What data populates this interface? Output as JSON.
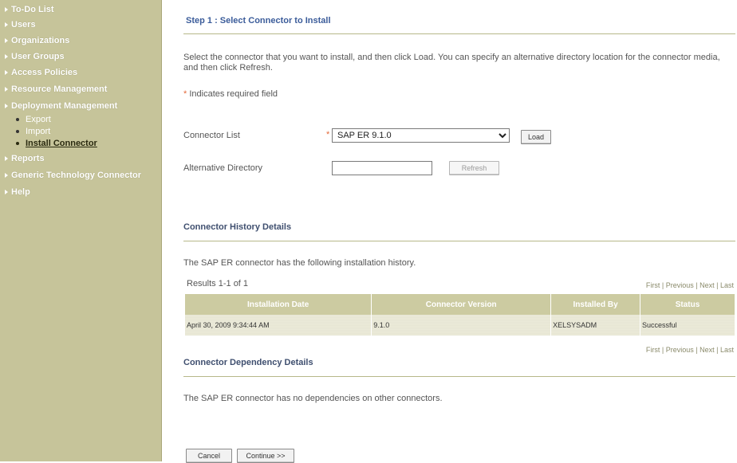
{
  "sidebar": {
    "items": [
      {
        "label": "To-Do List"
      },
      {
        "label": "Users"
      },
      {
        "label": "Organizations"
      },
      {
        "label": "User Groups"
      },
      {
        "label": "Access Policies"
      },
      {
        "label": "Resource Management"
      },
      {
        "label": "Deployment Management"
      },
      {
        "label": "Reports"
      },
      {
        "label": "Generic Technology Connector"
      },
      {
        "label": "Help"
      }
    ],
    "sub_items": [
      {
        "label": "Export"
      },
      {
        "label": "Import"
      },
      {
        "label": "Install Connector",
        "active": true
      }
    ]
  },
  "main": {
    "step_title": "Step 1 : Select Connector to Install",
    "instructions": "Select the connector that you want to install, and then click Load.  You can specify an alternative directory location for the connector media, and then click Refresh.",
    "required_star": "*",
    "required_note": "Indicates required field",
    "connector_list_label": "Connector List",
    "connector_selected": "SAP ER 9.1.0",
    "load_label": "Load",
    "alt_dir_label": "Alternative Directory",
    "alt_dir_value": "",
    "refresh_label": "Refresh",
    "history_title": "Connector History Details",
    "history_text": "The SAP ER connector has the following installation history.",
    "results_text": "Results 1-1 of 1",
    "pager": {
      "first": "First",
      "previous": "Previous",
      "next": "Next",
      "last": "Last",
      "sep": " | "
    },
    "history_table": {
      "headers": [
        "Installation Date",
        "Connector Version",
        "Installed By",
        "Status"
      ],
      "rows": [
        [
          "April 30, 2009 9:34:44 AM",
          "9.1.0",
          "XELSYSADM",
          "Successful"
        ]
      ]
    },
    "dependency_title": "Connector Dependency Details",
    "dependency_text": "The SAP ER connector has no dependencies on other connectors.",
    "cancel_label": "Cancel",
    "continue_label": "Continue >>"
  },
  "colors": {
    "sidebar_bg": "#c6c49a",
    "table_header_bg": "#cccba1",
    "table_row_bg": "#ecebd9",
    "section_rule": "#b7b88a",
    "required_star": "#e46a3a"
  }
}
